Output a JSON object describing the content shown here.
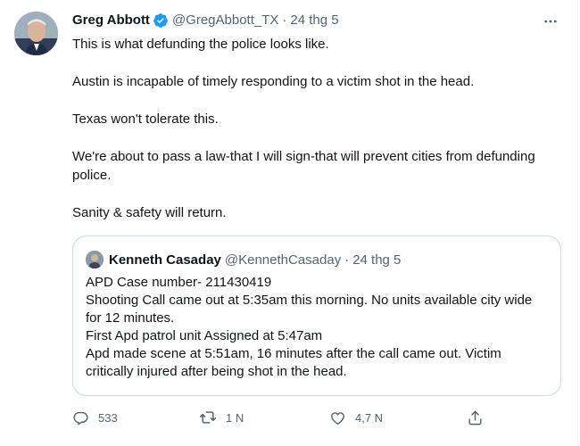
{
  "tweet": {
    "author_name": "Greg Abbott",
    "author_handle": "@GregAbbott_TX",
    "separator": "·",
    "date": "24 thg 5",
    "verified_icon": "verified-badge-icon",
    "more_icon": "more-options-icon",
    "lines": [
      "This is what defunding the police looks like.",
      "Austin is incapable of timely responding to a victim shot in the head.",
      "Texas won't tolerate this.",
      "We're about to pass a law-that I will sign-that will prevent cities from defunding police.",
      "Sanity & safety will return."
    ]
  },
  "quote": {
    "author_name": "Kenneth Casaday",
    "author_handle": "@KennethCasaday",
    "separator": "·",
    "date": "24 thg 5",
    "lines": [
      "APD Case number- 211430419",
      "Shooting Call came out at 5:35am this morning. No units available city wide for 12 minutes.",
      "First Apd patrol unit Assigned at 5:47am",
      "Apd made scene at 5:51am, 16 minutes after the call came out. Victim critically injured after being shot in the head."
    ]
  },
  "actions": {
    "reply_count": "533",
    "retweet_count": "1 N",
    "like_count": "4,7 N",
    "icons": [
      "reply-icon",
      "retweet-icon",
      "like-icon",
      "share-icon"
    ]
  },
  "colors": {
    "text": "#0f1419",
    "secondary": "#536471",
    "verified": "#1d9bf0",
    "border": "#cfd9de"
  }
}
